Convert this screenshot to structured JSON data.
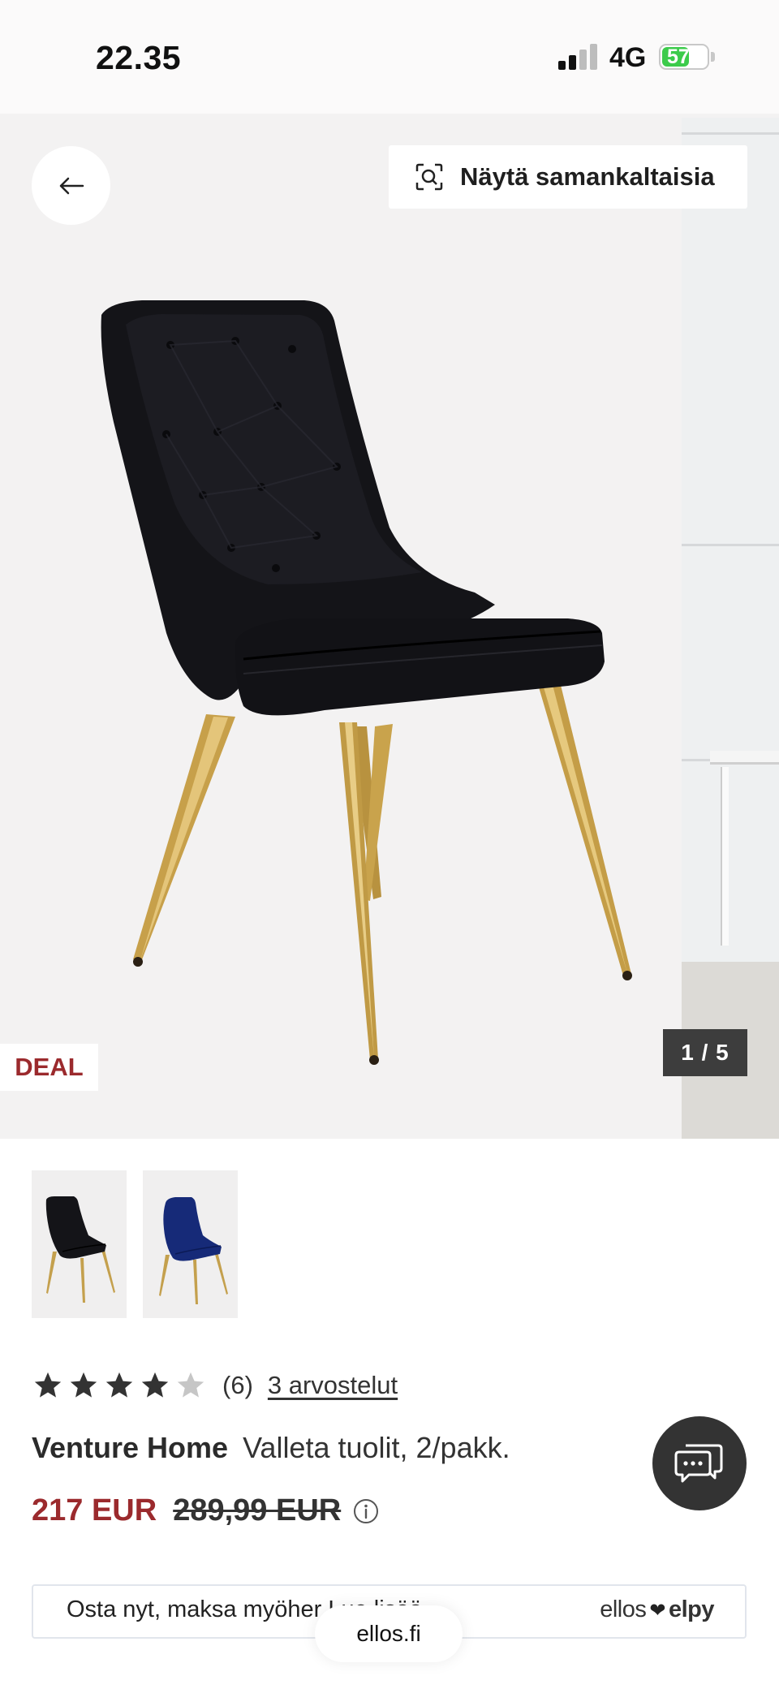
{
  "status_bar": {
    "time": "22.35",
    "network": "4G",
    "battery": "57"
  },
  "gallery": {
    "similar_button_label": "Näytä samankaltaisia",
    "deal_badge": "DEAL",
    "counter": "1 / 5",
    "colors": {
      "deal_red": "#9b2a2d",
      "counter_bg": "#3d3d3d"
    }
  },
  "thumbnails": [
    {
      "name": "black-chair-thumbnail",
      "color": "black"
    },
    {
      "name": "blue-chair-thumbnail",
      "color": "blue"
    }
  ],
  "rating": {
    "stars": 4,
    "max": 5,
    "count": "(6)",
    "reviews_link": "3 arvostelut"
  },
  "product": {
    "brand": "Venture Home",
    "name": "Valleta tuolit, 2/pakk.",
    "price": "217 EUR",
    "old_price": "289,99 EUR"
  },
  "bnpl": {
    "text": "Osta nyt, maksa myöher",
    "link": "Lue lisää",
    "brand_left": "ellos",
    "brand_right": "elpy"
  },
  "browser": {
    "url": "ellos.fi"
  },
  "icons": [
    "back-arrow-icon",
    "visual-search-icon",
    "star-icon",
    "info-icon",
    "chat-icon",
    "heart-icon"
  ]
}
